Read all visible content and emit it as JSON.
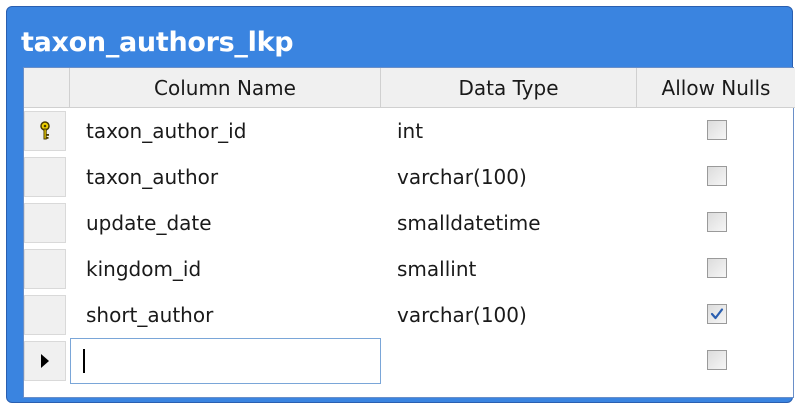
{
  "table": {
    "title": "taxon_authors_lkp",
    "columns": {
      "name": "Column Name",
      "type": "Data Type",
      "nulls": "Allow Nulls"
    },
    "rows": [
      {
        "name": "taxon_author_id",
        "type": "int",
        "allow_nulls": false,
        "primary_key": true
      },
      {
        "name": "taxon_author",
        "type": "varchar(100)",
        "allow_nulls": false,
        "primary_key": false
      },
      {
        "name": "update_date",
        "type": "smalldatetime",
        "allow_nulls": false,
        "primary_key": false
      },
      {
        "name": "kingdom_id",
        "type": "smallint",
        "allow_nulls": false,
        "primary_key": false
      },
      {
        "name": "short_author",
        "type": "varchar(100)",
        "allow_nulls": true,
        "primary_key": false
      }
    ],
    "new_row": {
      "name": "",
      "type": "",
      "allow_nulls": false
    }
  },
  "icons": {
    "primary_key": "key-icon",
    "current_row": "row-pointer-icon",
    "check": "checkmark-icon"
  },
  "colors": {
    "title_bar": "#3a84e0",
    "checkmark": "#2b5fb0"
  }
}
